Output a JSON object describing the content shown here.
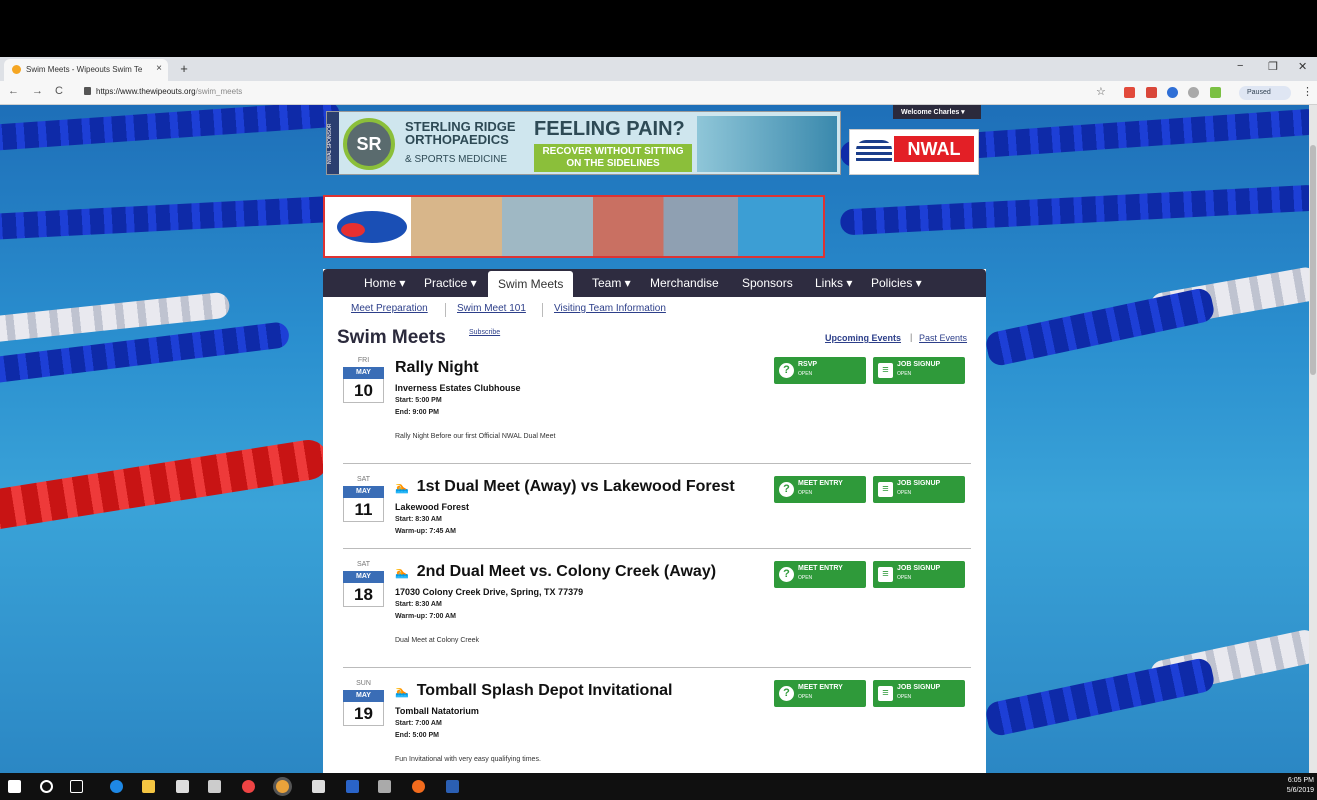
{
  "browser": {
    "tab_title": "Swim Meets - Wipeouts Swim Te",
    "tab_close": "×",
    "new_tab": "+",
    "url_host": "https://www.thewipeouts.org",
    "url_path": "/swim_meets",
    "paused_label": "Paused",
    "window_min": "−",
    "window_max": "❐",
    "window_close": "✕",
    "back": "←",
    "forward": "→",
    "reload": "C",
    "star": "☆",
    "menu": "⋮"
  },
  "header": {
    "welcome": "Welcome Charles ▾",
    "sponsor_tag": "NWAL SPONSOR",
    "sponsor_logo": "SR",
    "sponsor_name_1": "STERLING RIDGE",
    "sponsor_name_2": "ORTHOPAEDICS",
    "sponsor_name_3": "& SPORTS MEDICINE",
    "sponsor_headline": "FEELING PAIN?",
    "sponsor_sub": "RECOVER WITHOUT SITTING ON THE SIDELINES",
    "nwal": "NWAL"
  },
  "nav": {
    "items": [
      {
        "label": "Home ▾"
      },
      {
        "label": "Practice ▾"
      },
      {
        "label": "Swim Meets"
      },
      {
        "label": "Team ▾"
      },
      {
        "label": "Merchandise"
      },
      {
        "label": "Sponsors"
      },
      {
        "label": "Links ▾"
      },
      {
        "label": "Policies ▾"
      }
    ]
  },
  "subnav": {
    "items": [
      {
        "label": "Meet Preparation"
      },
      {
        "label": "Swim Meet 101"
      },
      {
        "label": "Visiting Team Information"
      }
    ]
  },
  "page": {
    "title": "Swim Meets",
    "subscribe": "Subscribe",
    "upcoming": "Upcoming Events",
    "separator": "|",
    "past": "Past Events"
  },
  "events": [
    {
      "dow": "FRI",
      "month": "MAY",
      "day": "10",
      "name": "Rally Night",
      "swimmer_icon": "",
      "location": "Inverness Estates Clubhouse",
      "time1": "Start: 5:00 PM",
      "time2": "End: 9:00 PM",
      "description": "Rally Night Before our first Official NWAL Dual Meet",
      "btn1_label": "RSVP",
      "btn1_status": "OPEN",
      "btn2_label": "JOB SIGNUP",
      "btn2_status": "OPEN"
    },
    {
      "dow": "SAT",
      "month": "MAY",
      "day": "11",
      "name": "1st Dual Meet (Away) vs Lakewood Forest",
      "swimmer_icon": "🏊",
      "location": "Lakewood Forest",
      "time1": "Start: 8:30 AM",
      "time2": "Warm-up: 7:45 AM",
      "description": "",
      "btn1_label": "MEET ENTRY",
      "btn1_status": "OPEN",
      "btn2_label": "JOB SIGNUP",
      "btn2_status": "OPEN"
    },
    {
      "dow": "SAT",
      "month": "MAY",
      "day": "18",
      "name": "2nd Dual Meet vs. Colony Creek (Away)",
      "swimmer_icon": "🏊",
      "location": "17030 Colony Creek Drive, Spring, TX 77379",
      "time1": "Start: 8:30 AM",
      "time2": "Warm-up: 7:00 AM",
      "description": "Dual Meet at Colony Creek",
      "btn1_label": "MEET ENTRY",
      "btn1_status": "OPEN",
      "btn2_label": "JOB SIGNUP",
      "btn2_status": "OPEN"
    },
    {
      "dow": "SUN",
      "month": "MAY",
      "day": "19",
      "name": "Tomball Splash Depot Invitational",
      "swimmer_icon": "🏊",
      "location": "Tomball Natatorium",
      "time1": "Start: 7:00 AM",
      "time2": "End: 5:00 PM",
      "description": "Fun Invitational with very easy qualifying times.",
      "btn1_label": "MEET ENTRY",
      "btn1_status": "OPEN",
      "btn2_label": "JOB SIGNUP",
      "btn2_status": "OPEN"
    }
  ],
  "taskbar": {
    "time": "6:05 PM",
    "date": "5/6/2019"
  },
  "colors": {
    "nav_bg": "#2e2c40",
    "button_green": "#2f9a3a",
    "month_blue": "#3a6db6",
    "link_blue": "#2d3f8a"
  }
}
